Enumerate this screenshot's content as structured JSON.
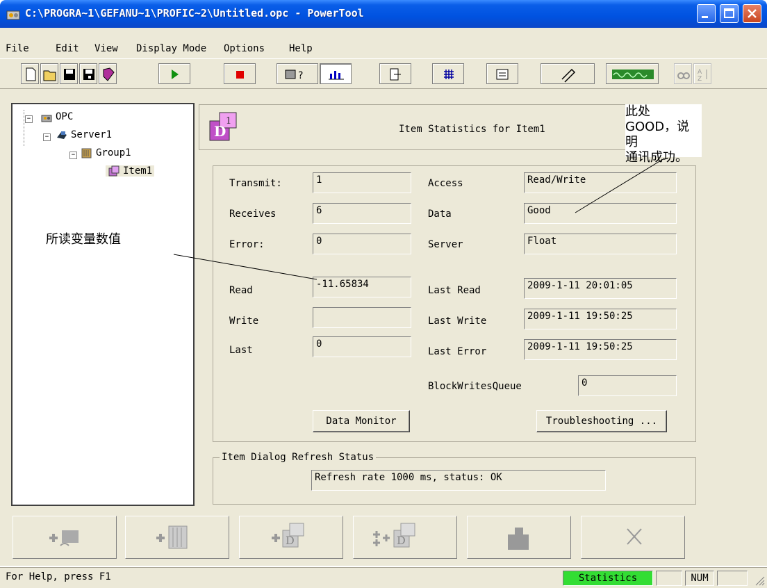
{
  "window": {
    "title": "C:\\PROGRA~1\\GEFANU~1\\PROFIC~2\\Untitled.opc - PowerTool"
  },
  "menu": [
    "File",
    "Edit",
    "View",
    "Display Mode",
    "Options",
    "Help"
  ],
  "toolbar": {
    "icons": [
      "new-icon",
      "open-icon",
      "save-icon",
      "save-as-icon",
      "book-icon",
      "run-icon",
      "stop-icon",
      "tools-icon",
      "statistics-icon",
      "export-icon",
      "grid-icon",
      "properties-icon",
      "wrench-icon",
      "monitor-icon",
      "find-icon",
      "sort-icon"
    ]
  },
  "tree": {
    "root": "OPC",
    "server": "Server1",
    "group": "Group1",
    "item": "Item1"
  },
  "header": {
    "title": "Item Statistics for Item1"
  },
  "stats": {
    "transmit_label": "Transmit:",
    "transmit": "1",
    "receives_label": "Receives",
    "receives": "6",
    "error_label": "Error:",
    "error": "0",
    "read_label": "Read",
    "read": "-11.65834",
    "write_label": "Write",
    "write": "",
    "last_label": "Last",
    "last": "0",
    "access_label": "Access",
    "access": "Read/Write",
    "data_label": "Data",
    "data": "Good",
    "server_label": "Server",
    "server": "Float",
    "last_read_label": "Last Read",
    "last_read": "2009-1-11 20:01:05",
    "last_write_label": "Last Write",
    "last_write": "2009-1-11 19:50:25",
    "last_error_label": "Last Error",
    "last_error": "2009-1-11 19:50:25",
    "block_label": "BlockWritesQueue",
    "block": "0"
  },
  "buttons": {
    "data_monitor": "Data Monitor",
    "troubleshooting": "Troubleshooting ..."
  },
  "refresh": {
    "legend": "Item Dialog Refresh Status",
    "status": "Refresh rate 1000 ms, status: OK"
  },
  "annotations": {
    "read_note": "所读变量数值",
    "good_note_line1": "此处GOOD，说明",
    "good_note_line2": "通讯成功。"
  },
  "statusbar": {
    "help": "For Help, press F1",
    "mode": "Statistics",
    "num": "NUM"
  },
  "colors": {
    "titlebar": "#0052e0",
    "face": "#ece9d8",
    "statistics_panel": "#33dd33"
  }
}
